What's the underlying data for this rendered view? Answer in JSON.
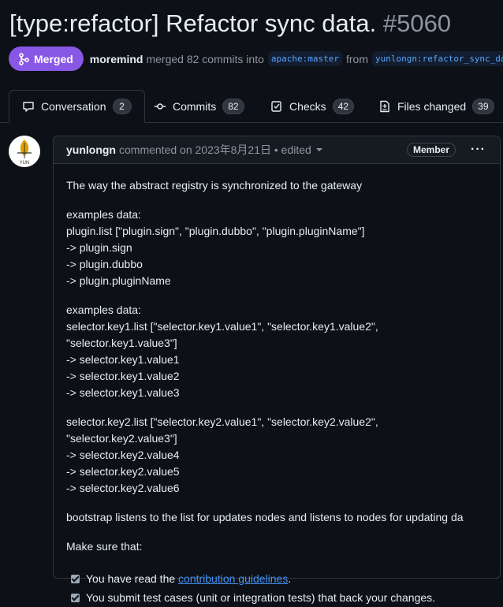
{
  "pr": {
    "title": "[type:refactor] Refactor sync data.",
    "number": "#5060",
    "state": "Merged",
    "author": "moremind",
    "action_text": "merged 82 commits into",
    "base_branch": "apache:master",
    "from_text": "from",
    "head_branch": "yunlongn:refactor_sync_data"
  },
  "tabs": [
    {
      "label": "Conversation",
      "count": "2"
    },
    {
      "label": "Commits",
      "count": "82"
    },
    {
      "label": "Checks",
      "count": "42"
    },
    {
      "label": "Files changed",
      "count": "39"
    }
  ],
  "comment": {
    "avatar_text": "YUN",
    "author": "yunlongn",
    "meta": "commented on 2023年8月21日 • edited",
    "role": "Member",
    "paragraphs": [
      "The way the abstract registry is synchronized to the gateway",
      "examples data:\nplugin.list [\"plugin.sign\", \"plugin.dubbo\", \"plugin.pluginName\"]\n-> plugin.sign\n-> plugin.dubbo\n-> plugin.pluginName",
      "examples data:\nselector.key1.list [\"selector.key1.value1\", \"selector.key1.value2\", \"selector.key1.value3\"]\n-> selector.key1.value1\n-> selector.key1.value2\n-> selector.key1.value3",
      "selector.key2.list [\"selector.key2.value1\", \"selector.key2.value2\", \"selector.key2.value3\"]\n-> selector.key2.value4\n-> selector.key2.value5\n-> selector.key2.value6",
      "bootstrap listens to the list for updates nodes and listens to nodes for updating da",
      "Make sure that:"
    ],
    "tasks": [
      {
        "prefix": "You have read the ",
        "link": "contribution guidelines",
        "suffix": "."
      },
      {
        "prefix": "You submit test cases (unit or integration tests) that back your changes.",
        "link": "",
        "suffix": ""
      }
    ]
  }
}
